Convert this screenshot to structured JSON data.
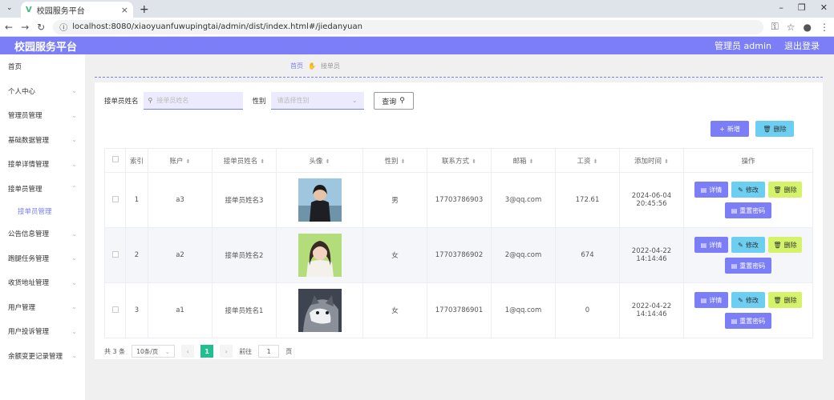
{
  "browser": {
    "tab_title": "校园服务平台",
    "url": "localhost:8080/xiaoyuanfuwupingtai/admin/dist/index.html#/jiedanyuan",
    "new_tab": "+",
    "tab_close": "×"
  },
  "app": {
    "title": "校园服务平台",
    "user_label": "管理员 admin",
    "logout": "退出登录",
    "accent": "#7b7ef7"
  },
  "sidebar": {
    "items": [
      {
        "label": "首页"
      },
      {
        "label": "个人中心"
      },
      {
        "label": "管理员管理"
      },
      {
        "label": "基础数据管理"
      },
      {
        "label": "接单详情管理"
      },
      {
        "label": "接单员管理"
      },
      {
        "label": "公告信息管理"
      },
      {
        "label": "跑腿任务管理"
      },
      {
        "label": "收货地址管理"
      },
      {
        "label": "用户管理"
      },
      {
        "label": "用户投诉管理"
      },
      {
        "label": "余额变更记录管理"
      }
    ],
    "active_sub": "接单员管理"
  },
  "breadcrumb": {
    "home": "首页",
    "current": "接单员"
  },
  "search": {
    "name_label": "接单员姓名",
    "name_placeholder": "接单员姓名",
    "gender_label": "性别",
    "gender_placeholder": "请选择性别",
    "query_button": "查询"
  },
  "toolbar": {
    "add": "新增",
    "delete": "删除"
  },
  "table": {
    "headers": [
      "索引",
      "账户",
      "接单员姓名",
      "头像",
      "性别",
      "联系方式",
      "邮箱",
      "工资",
      "添加时间",
      "操作"
    ],
    "rows": [
      {
        "index": "1",
        "account": "a3",
        "name": "接单员姓名3",
        "gender": "男",
        "phone": "17703786903",
        "email": "3@qq.com",
        "salary": "172.61",
        "time": "2024-06-04 20:45:56"
      },
      {
        "index": "2",
        "account": "a2",
        "name": "接单员姓名2",
        "gender": "女",
        "phone": "17703786902",
        "email": "2@qq.com",
        "salary": "674",
        "time": "2022-04-22 14:14:46"
      },
      {
        "index": "3",
        "account": "a1",
        "name": "接单员姓名1",
        "gender": "女",
        "phone": "17703786901",
        "email": "1@qq.com",
        "salary": "0",
        "time": "2022-04-22 14:14:46"
      }
    ],
    "ops": {
      "detail": "详情",
      "edit": "修改",
      "delete": "删除",
      "reset": "重置密码"
    }
  },
  "pager": {
    "total": "共 3 条",
    "size": "10条/页",
    "current": "1",
    "goto": "前往",
    "goto_value": "1",
    "page_unit": "页"
  }
}
